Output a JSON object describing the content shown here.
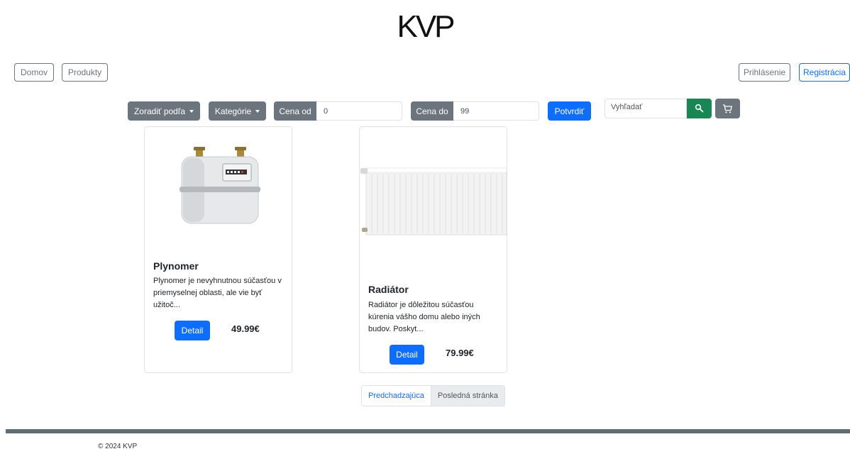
{
  "header": {
    "logo": "KVP"
  },
  "nav": {
    "home": "Domov",
    "products": "Produkty",
    "login": "Prihlásenie",
    "register": "Registrácia"
  },
  "filters": {
    "sort_label": "Zoradiť podľa",
    "category_label": "Kategórie",
    "price_from_label": "Cena od",
    "price_from_value": "0",
    "price_to_label": "Cena do",
    "price_to_value": "99",
    "confirm_label": "Potvrdiť",
    "search_placeholder": "Vyhľadať"
  },
  "products": [
    {
      "name": "Plynomer",
      "description": "Plynomer je nevyhnutnou súčasťou v priemyselnej oblasti, ale vie byť užitoč...",
      "detail_label": "Detail",
      "price": "49.99€"
    },
    {
      "name": "Radiátor",
      "description": "Radiátor je dôležitou súčasťou kúrenia vášho domu alebo iných budov. Poskyt...",
      "detail_label": "Detail",
      "price": "79.99€"
    }
  ],
  "pagination": {
    "previous": "Predchadzajúca",
    "last": "Posledná stránka"
  },
  "footer": {
    "copyright": "© 2024 KVP"
  },
  "colors": {
    "primary": "#0d6efd",
    "secondary": "#6c757d",
    "success": "#198754",
    "footer": "#5f6b75"
  }
}
